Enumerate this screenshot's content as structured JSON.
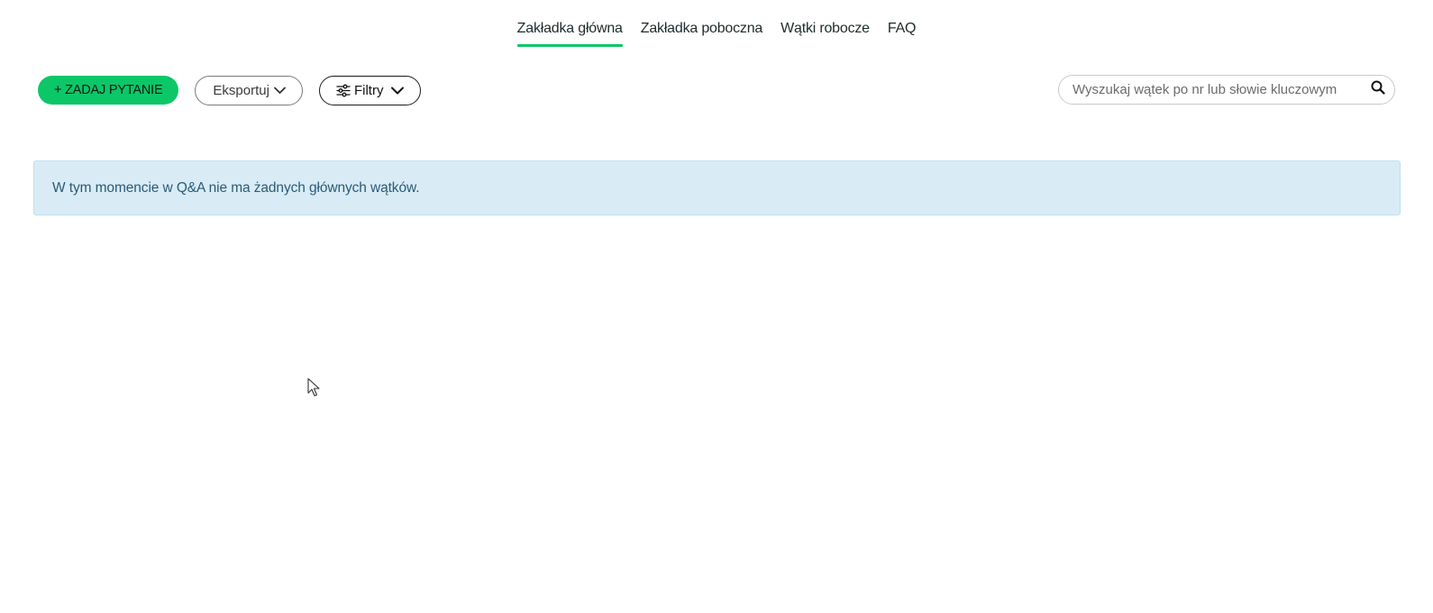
{
  "tabs": [
    {
      "label": "Zakładka główna",
      "active": true
    },
    {
      "label": "Zakładka poboczna",
      "active": false
    },
    {
      "label": "Wątki robocze",
      "active": false
    },
    {
      "label": "FAQ",
      "active": false
    }
  ],
  "toolbar": {
    "ask_label": "+ ZADAJ PYTANIE",
    "export_label": "Eksportuj",
    "filters_label": "Filtry"
  },
  "search": {
    "placeholder": "Wyszukaj wątek po nr lub słowie kluczowym",
    "value": ""
  },
  "alert": {
    "message": "W tym momencie w Q&A nie ma żadnych głównych wątków."
  },
  "colors": {
    "accent": "#0bc768",
    "alert_bg": "#d9ecf5",
    "alert_text": "#2a5a78"
  },
  "icons": {
    "export_chevron": "chevron-down-icon",
    "filters": "sliders-icon",
    "filters_chevron": "chevron-down-icon",
    "search": "search-icon",
    "cursor": "mouse-cursor-icon"
  }
}
